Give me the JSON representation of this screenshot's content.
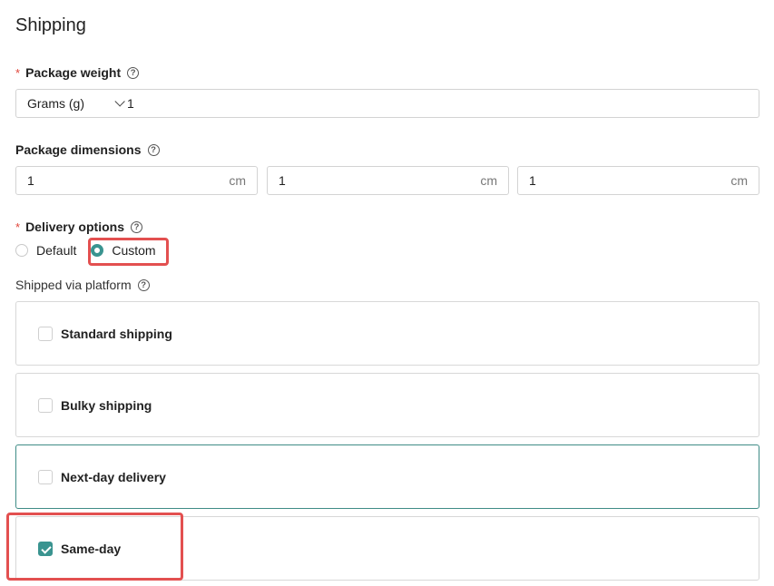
{
  "section_title": "Shipping",
  "weight": {
    "label": "Package weight",
    "required_mark": "*",
    "unit": "Grams (g)",
    "value": "1"
  },
  "dimensions": {
    "label": "Package dimensions",
    "fields": [
      {
        "value": "1",
        "unit": "cm"
      },
      {
        "value": "1",
        "unit": "cm"
      },
      {
        "value": "1",
        "unit": "cm"
      }
    ]
  },
  "delivery": {
    "label": "Delivery options",
    "required_mark": "*",
    "options": [
      {
        "label": "Default",
        "selected": false
      },
      {
        "label": "Custom",
        "selected": true
      }
    ]
  },
  "platform": {
    "label": "Shipped via platform",
    "items": [
      {
        "label": "Standard shipping",
        "checked": false
      },
      {
        "label": "Bulky shipping",
        "checked": false
      },
      {
        "label": "Next-day delivery",
        "checked": false
      },
      {
        "label": "Same-day",
        "checked": true
      }
    ]
  },
  "colors": {
    "accent": "#3a9490",
    "required": "#e0463b",
    "highlight": "#e35050"
  },
  "icons": {
    "help": "?"
  }
}
